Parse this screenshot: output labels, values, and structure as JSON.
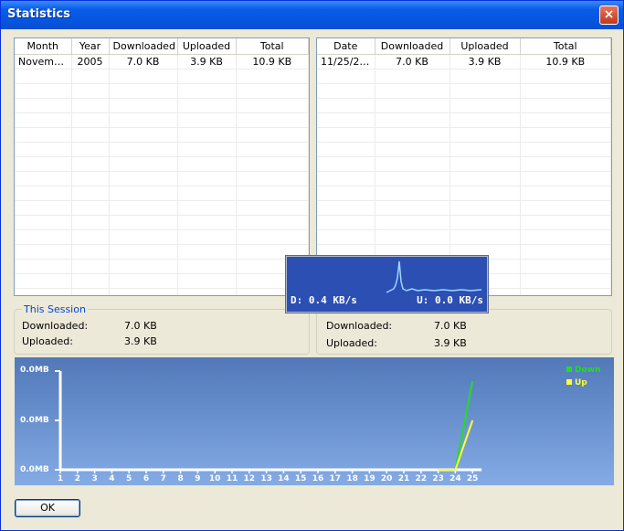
{
  "window": {
    "title": "Statistics",
    "close_label": "×"
  },
  "monthly": {
    "columns": [
      "Month",
      "Year",
      "Downloaded",
      "Uploaded",
      "Total"
    ],
    "rows": [
      [
        "November",
        "2005",
        "7.0 KB",
        "3.9 KB",
        "10.9 KB"
      ]
    ]
  },
  "daily": {
    "columns": [
      "Date",
      "Downloaded",
      "Uploaded",
      "Total"
    ],
    "rows": [
      [
        "11/25/20...",
        "7.0 KB",
        "3.9 KB",
        "10.9 KB"
      ]
    ]
  },
  "session": {
    "title": "This Session",
    "downloaded_label": "Downloaded:",
    "downloaded_value": "7.0  KB",
    "uploaded_label": "Uploaded:",
    "uploaded_value": "3.9  KB"
  },
  "since": {
    "downloaded_label": "Downloaded:",
    "downloaded_value": "7.0 KB",
    "uploaded_label": "Uploaded:",
    "uploaded_value": "3.9 KB"
  },
  "speed": {
    "down": "D: 0.4 KB/s",
    "up": "U: 0.0 KB/s",
    "color_bg": "#2b4fb3",
    "color_line": "#9fd6ff"
  },
  "chart_data": {
    "type": "line",
    "x": [
      1,
      2,
      3,
      4,
      5,
      6,
      7,
      8,
      9,
      10,
      11,
      12,
      13,
      14,
      15,
      16,
      17,
      18,
      19,
      20,
      21,
      22,
      23,
      24,
      25
    ],
    "y_tick_labels": [
      "0.0MB",
      "0.0MB",
      "0.0MB"
    ],
    "series": [
      {
        "name": "Down",
        "color": "#22dd22",
        "values": [
          0,
          0,
          0,
          0,
          0,
          0,
          0,
          0,
          0,
          0,
          0,
          0,
          0,
          0,
          0,
          0,
          0,
          0,
          0,
          0,
          0,
          0,
          0,
          0,
          7.0
        ]
      },
      {
        "name": "Up",
        "color": "#ffff33",
        "values": [
          0,
          0,
          0,
          0,
          0,
          0,
          0,
          0,
          0,
          0,
          0,
          0,
          0,
          0,
          0,
          0,
          0,
          0,
          0,
          0,
          0,
          0,
          0,
          0,
          3.9
        ]
      }
    ],
    "ylim": [
      0,
      7.8
    ]
  },
  "buttons": {
    "ok": "OK"
  }
}
